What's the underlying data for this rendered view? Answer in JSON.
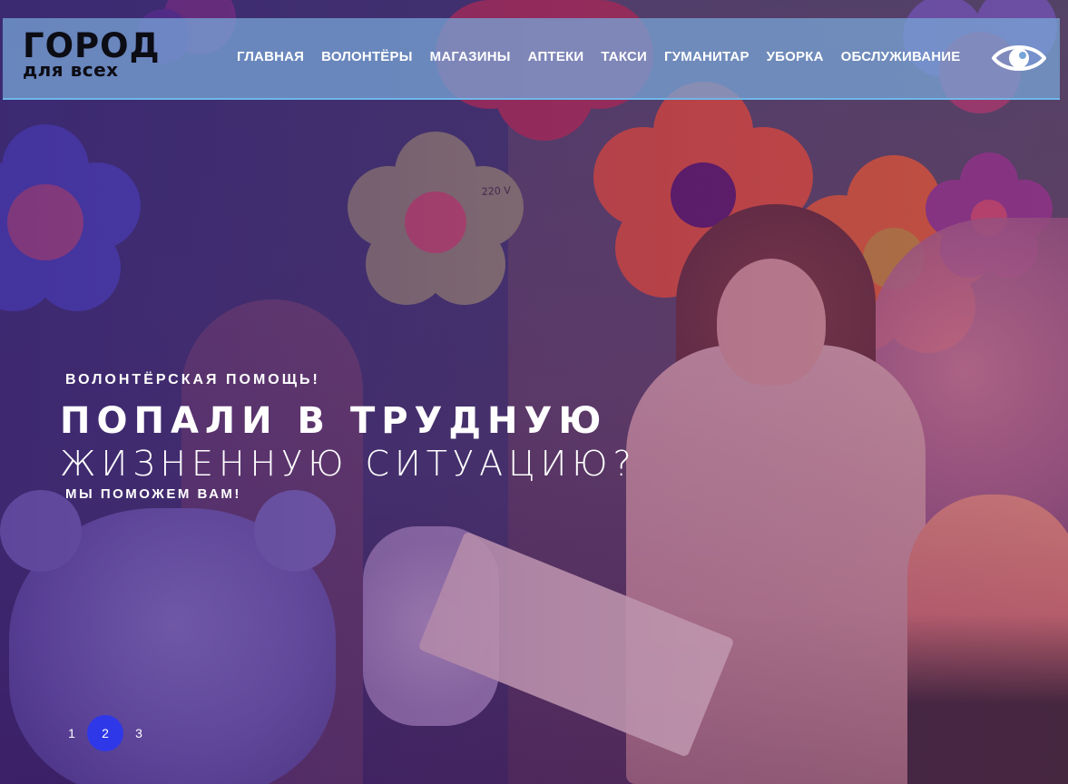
{
  "header": {
    "logo_main": "ГОРОД",
    "logo_sub": "для всех",
    "nav": [
      {
        "label": "ГЛАВНАЯ"
      },
      {
        "label": "ВОЛОНТЁРЫ"
      },
      {
        "label": "МАГАЗИНЫ"
      },
      {
        "label": "АПТЕКИ"
      },
      {
        "label": "ТАКСИ"
      },
      {
        "label": "ГУМАНИТАР"
      },
      {
        "label": "УБОРКА"
      },
      {
        "label": "ОБСЛУЖИВАНИЕ"
      }
    ],
    "accessibility_icon": "eye-icon"
  },
  "hero": {
    "eyebrow": "ВОЛОНТЁРСКАЯ ПОМОЩЬ!",
    "headline_1": "ПОПАЛИ В ТРУДНУЮ",
    "headline_2": "ЖИЗНЕННУЮ СИТУАЦИЮ?",
    "subline": "МЫ ПОМОЖЕМ ВАМ!",
    "wall_label": "220 V"
  },
  "pager": {
    "pages": [
      "1",
      "2",
      "3"
    ],
    "active": "2"
  },
  "colors": {
    "header_bg": "#78a5d7",
    "header_border": "#6fb7ea",
    "pager_active": "#2f38e8",
    "logo_text": "#0c0c14"
  }
}
